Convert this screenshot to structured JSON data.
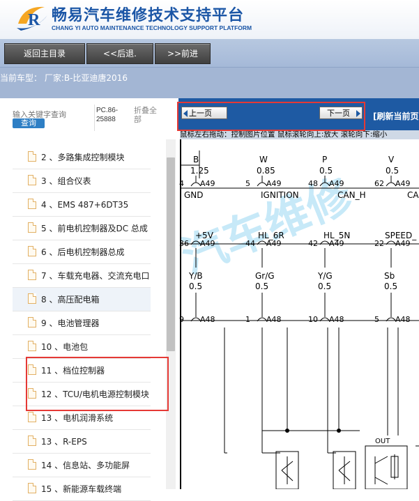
{
  "header": {
    "title": "畅易汽车维修技术支持平台",
    "subtitle": "CHANG YI AUTO MAINTENANCE TECHNOLOGY SUPPORT PLATFORM",
    "logo_letter": "R"
  },
  "nav": {
    "home": "返回主目录",
    "back": "<<后退.",
    "forward": ">>前进"
  },
  "car_type": "当前车型： 厂家:B-比亚迪唐2016",
  "search": {
    "placeholder": "输入关键字查询",
    "button": "查询",
    "pc_label": "PC.86-25888",
    "collapse_all": "折叠全部"
  },
  "tree": [
    {
      "label": "2 、多路集成控制模块"
    },
    {
      "label": "3 、组合仪表"
    },
    {
      "label": "4 、EMS 487+6DT35"
    },
    {
      "label": "5 、前电机控制器及DC 总成"
    },
    {
      "label": "6 、后电机控制器总成"
    },
    {
      "label": "7 、车载充电器、交流充电口"
    },
    {
      "label": "8 、高压配电箱",
      "selected": true
    },
    {
      "label": "9 、电池管理器"
    },
    {
      "label": "10 、电池包"
    },
    {
      "label": "11 、档位控制器"
    },
    {
      "label": "12 、TCU/电机电源控制模块"
    },
    {
      "label": "13 、电机润滑系统"
    },
    {
      "label": "13 、R-EPS"
    },
    {
      "label": "14 、信息站、多功能屏"
    },
    {
      "label": "15 、新能源车载终端"
    }
  ],
  "viewer": {
    "prev": "上一页",
    "next": "下一页",
    "refresh": "[刷新当前页",
    "hint": "鼠标左右拖动：控制图片位置  鼠标滚轮向上:放大  滚轮向下:缩小",
    "watermark": "汽车维修"
  },
  "diagram": {
    "row1_letters": [
      "B",
      "W",
      "P",
      "V"
    ],
    "row1_sizes": [
      "1.25",
      "0.85",
      "0.5",
      "0.5"
    ],
    "row1_pins": [
      "4",
      "5",
      "48",
      "62"
    ],
    "connector_a": "A49",
    "signals1": [
      "GND",
      "IGNITION",
      "CAN_H",
      "CA"
    ],
    "signals2": [
      "+5V",
      "HL_6R",
      "HL_5N",
      "SPEED_"
    ],
    "row2_pins": [
      "36",
      "44",
      "42",
      "22"
    ],
    "colors": [
      "Y/B",
      "Gr/G",
      "Y/G",
      "Sb"
    ],
    "sizes2": [
      "0.5",
      "0.5",
      "0.5",
      "0.5"
    ],
    "row3_pins": [
      "9",
      "1",
      "10",
      "5"
    ],
    "connector_b": "A48",
    "out_label": "OUT"
  },
  "colors": {
    "brand_blue": "#1b56a6",
    "nav_bg": "#a5b9d8",
    "viewer_bar": "#1e5aa3",
    "highlight_red": "#e53935"
  }
}
